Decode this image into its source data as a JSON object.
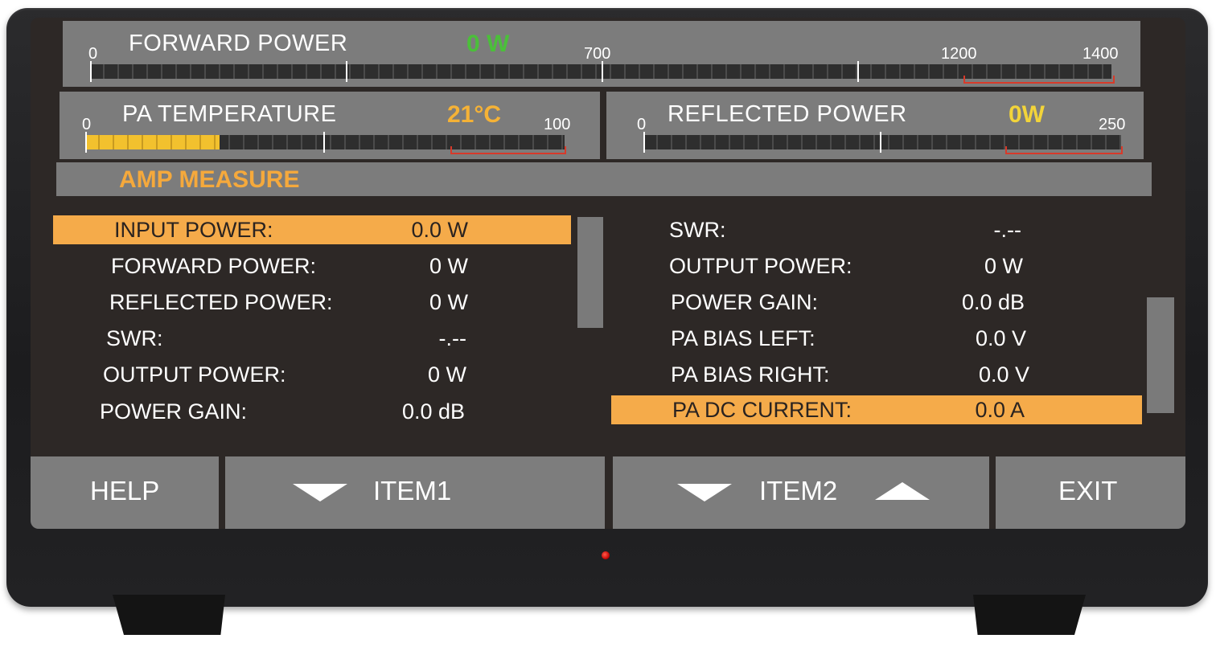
{
  "gauges": {
    "forward_power": {
      "title": "FORWARD POWER",
      "value": "0 W",
      "value_color": "#4bbf3a",
      "ticks": [
        "0",
        "700",
        "1200",
        "1400"
      ],
      "fill_fraction": 0.0
    },
    "pa_temperature": {
      "title": "PA TEMPERATURE",
      "value": "21°C",
      "value_color": "#f5b236",
      "ticks": [
        "0",
        "100"
      ],
      "fill_fraction": 0.21
    },
    "reflected_power": {
      "title": "REFLECTED POWER",
      "value": "0W",
      "value_color": "#f2d43a",
      "ticks": [
        "0",
        "250"
      ],
      "fill_fraction": 0.0
    }
  },
  "section": {
    "title": "AMP MEASURE"
  },
  "left_rows": [
    {
      "label": "INPUT POWER:",
      "value": "0.0 W",
      "selected": true
    },
    {
      "label": "FORWARD POWER:",
      "value": "0 W",
      "selected": false
    },
    {
      "label": "REFLECTED POWER:",
      "value": "0 W",
      "selected": false
    },
    {
      "label": "SWR:",
      "value": "-.--",
      "selected": false
    },
    {
      "label": "OUTPUT POWER:",
      "value": "0 W",
      "selected": false
    },
    {
      "label": "POWER GAIN:",
      "value": "0.0 dB",
      "selected": false
    }
  ],
  "right_rows": [
    {
      "label": "SWR:",
      "value": "-.--",
      "selected": false
    },
    {
      "label": "OUTPUT POWER:",
      "value": "0 W",
      "selected": false
    },
    {
      "label": "POWER GAIN:",
      "value": "0.0 dB",
      "selected": false
    },
    {
      "label": "PA BIAS LEFT:",
      "value": "0.0 V",
      "selected": false
    },
    {
      "label": "PA BIAS RIGHT:",
      "value": "0.0 V",
      "selected": false
    },
    {
      "label": "PA DC CURRENT:",
      "value": "0.0 A",
      "selected": true
    }
  ],
  "softkeys": {
    "help": "HELP",
    "item1": "ITEM1",
    "item2": "ITEM2",
    "exit": "EXIT"
  },
  "colors": {
    "highlight": "#f5ab4a",
    "section_title": "#f5a93c",
    "panel": "#7c7c7c",
    "screen_bg": "#2d2826",
    "status_led": "#d40000"
  }
}
